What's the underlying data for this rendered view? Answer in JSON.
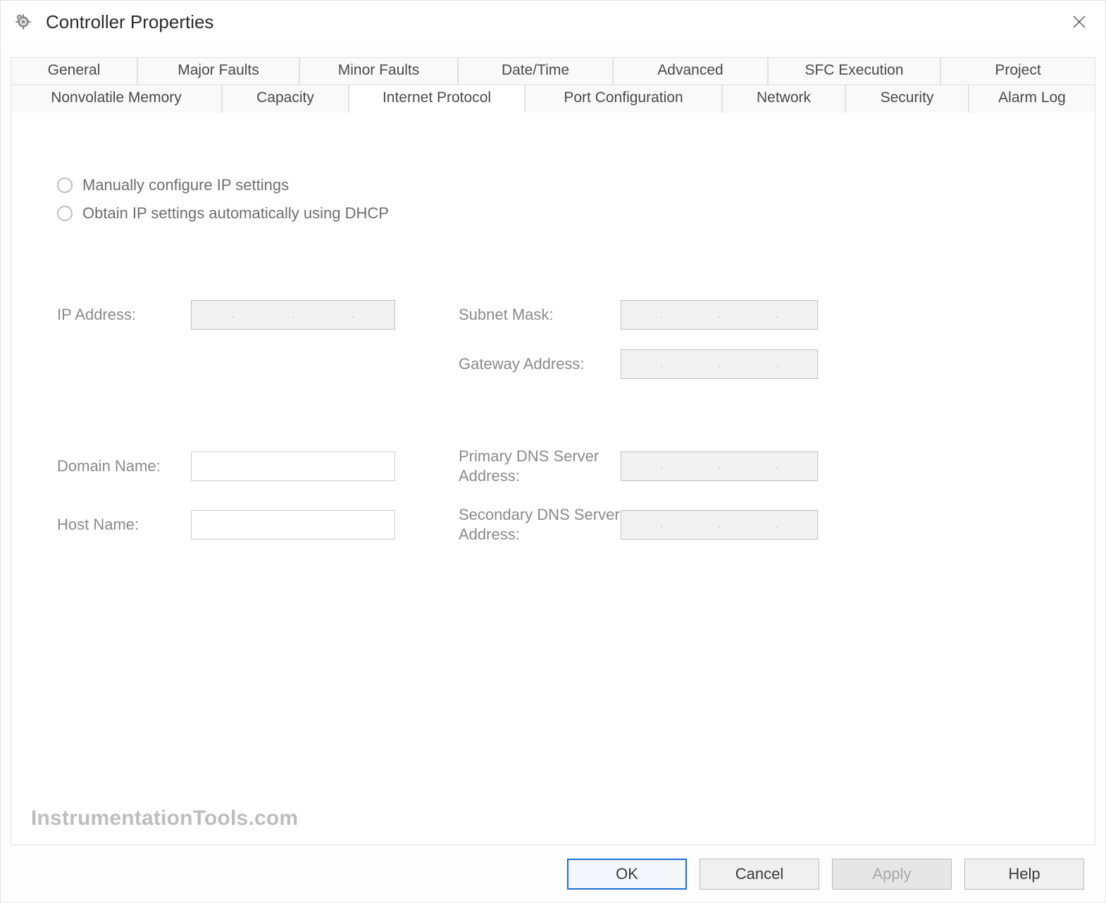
{
  "title": "Controller Properties",
  "tabs_row1": [
    "General",
    "Major Faults",
    "Minor Faults",
    "Date/Time",
    "Advanced",
    "SFC Execution",
    "Project"
  ],
  "tabs_row2": [
    "Nonvolatile Memory",
    "Capacity",
    "Internet Protocol",
    "Port Configuration",
    "Network",
    "Security",
    "Alarm Log"
  ],
  "active_tab": "Internet Protocol",
  "radio": {
    "manual": "Manually configure IP settings",
    "dhcp": "Obtain IP settings automatically using DHCP"
  },
  "labels": {
    "ip_address": "IP Address:",
    "subnet_mask": "Subnet Mask:",
    "gateway": "Gateway Address:",
    "domain_name": "Domain Name:",
    "host_name": "Host Name:",
    "primary_dns": "Primary DNS Server Address:",
    "secondary_dns": "Secondary DNS Server Address:"
  },
  "values": {
    "ip_address": "",
    "subnet_mask": "",
    "gateway": "",
    "domain_name": "",
    "host_name": "",
    "primary_dns": "",
    "secondary_dns": ""
  },
  "buttons": {
    "ok": "OK",
    "cancel": "Cancel",
    "apply": "Apply",
    "help": "Help"
  },
  "watermark": "InstrumentationTools.com"
}
